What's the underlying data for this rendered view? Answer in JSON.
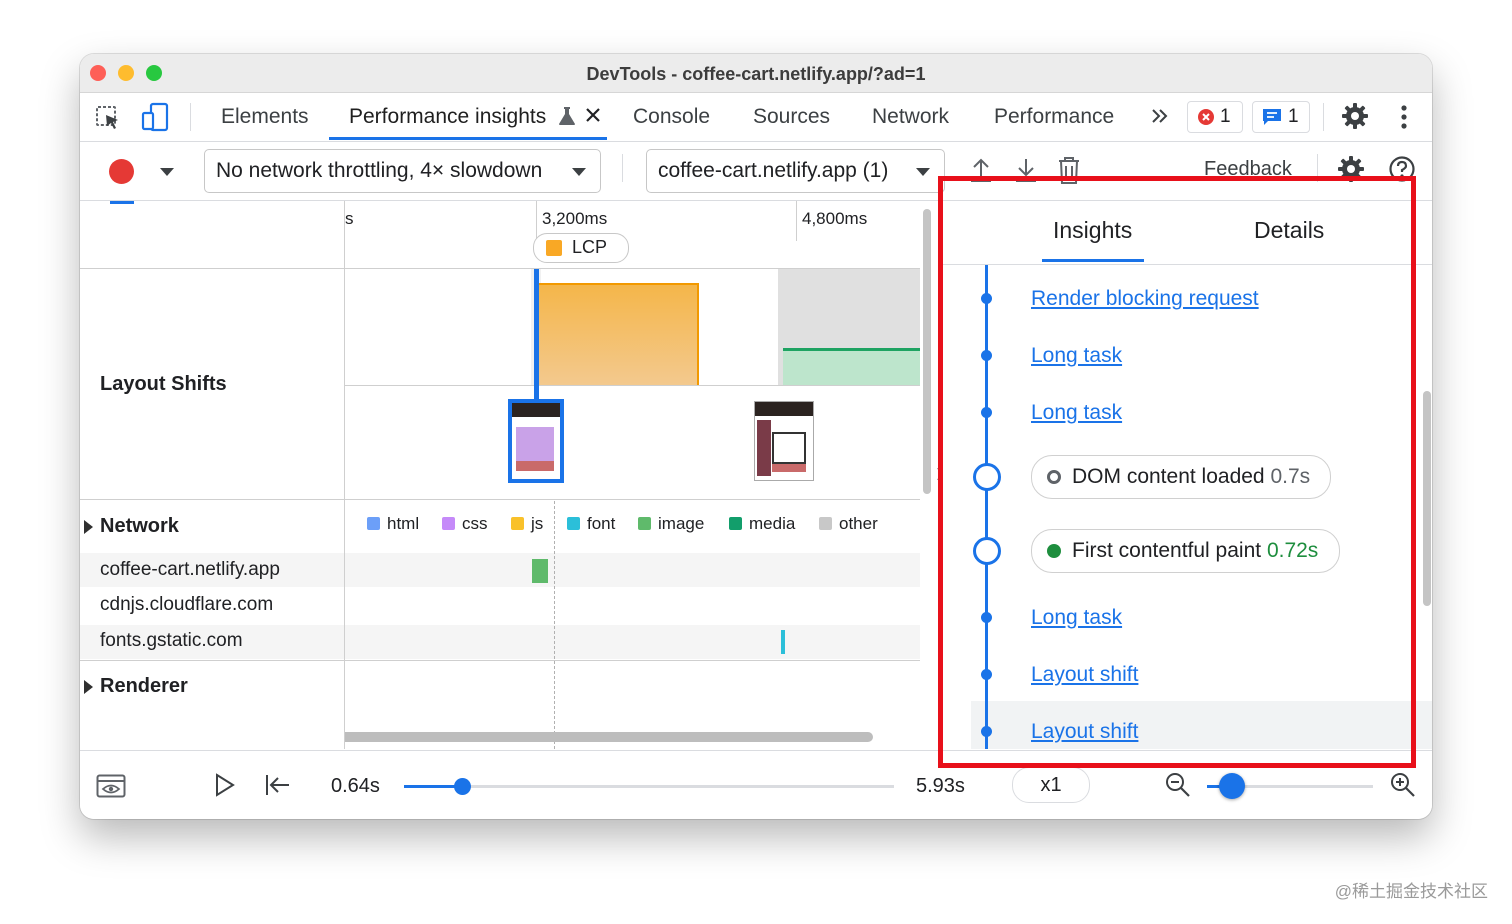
{
  "window": {
    "title": "DevTools - coffee-cart.netlify.app/?ad=1"
  },
  "tabs": [
    {
      "label": "Elements"
    },
    {
      "label": "Performance insights"
    },
    {
      "label": "Console"
    },
    {
      "label": "Sources"
    },
    {
      "label": "Network"
    },
    {
      "label": "Performance"
    }
  ],
  "badges": {
    "errors": "1",
    "messages": "1"
  },
  "toolbar": {
    "throttling": "No network throttling, 4× slowdown",
    "recording": "coffee-cart.netlify.app (1)",
    "feedback": "Feedback"
  },
  "timeline": {
    "ticks": [
      "s",
      "3,200ms",
      "4,800ms"
    ],
    "lcp_label": "LCP",
    "tracks": {
      "layout_shifts": "Layout Shifts",
      "network": "Network",
      "renderer": "Renderer"
    },
    "hosts": [
      "coffee-cart.netlify.app",
      "cdnjs.cloudflare.com",
      "fonts.gstatic.com"
    ],
    "legend": [
      {
        "label": "html",
        "color": "#6c9ff8"
      },
      {
        "label": "css",
        "color": "#c58af9"
      },
      {
        "label": "js",
        "color": "#f9c12a"
      },
      {
        "label": "font",
        "color": "#2bbfd9"
      },
      {
        "label": "image",
        "color": "#5fba6b"
      },
      {
        "label": "media",
        "color": "#129e6b"
      },
      {
        "label": "other",
        "color": "#c8c8c8"
      }
    ]
  },
  "playback": {
    "current": "0.64s",
    "end": "5.93s",
    "speed": "x1",
    "progress": 0.12,
    "zoom": 0.15
  },
  "insights": {
    "tabs": [
      "Insights",
      "Details"
    ],
    "items": [
      {
        "type": "link",
        "label": "Render blocking request"
      },
      {
        "type": "link",
        "label": "Long task"
      },
      {
        "type": "link",
        "label": "Long task"
      },
      {
        "type": "marker",
        "label": "DOM content loaded",
        "value": "0.7s",
        "color": "#5f6368"
      },
      {
        "type": "marker",
        "label": "First contentful paint",
        "value": "0.72s",
        "color": "#1e8e3e"
      },
      {
        "type": "link",
        "label": "Long task"
      },
      {
        "type": "link",
        "label": "Layout shift"
      },
      {
        "type": "link",
        "label": "Layout shift"
      }
    ]
  },
  "watermark": "@稀土掘金技术社区"
}
